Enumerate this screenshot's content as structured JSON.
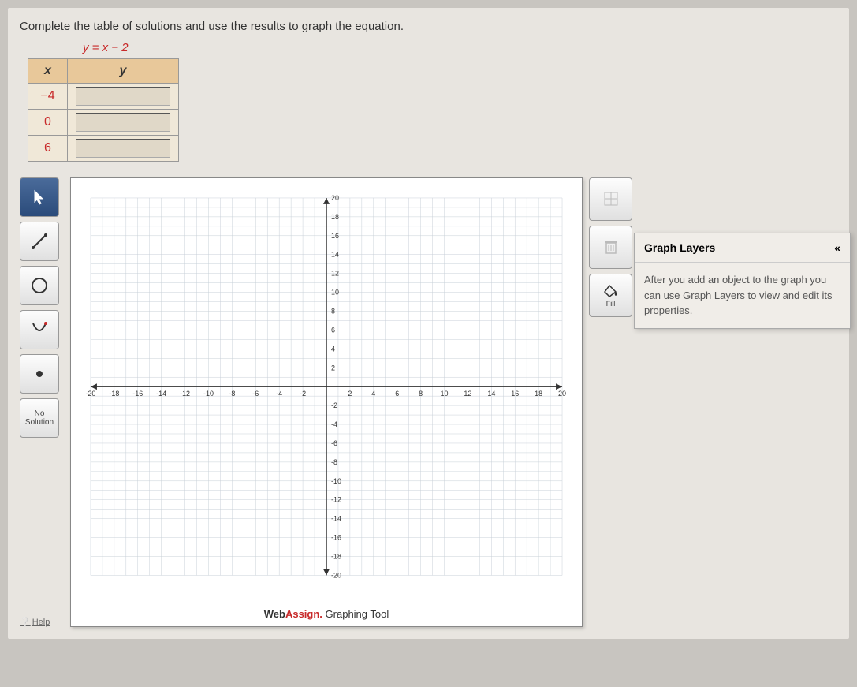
{
  "instruction": "Complete the table of solutions and use the results to graph the equation.",
  "equation": "y = x − 2",
  "table": {
    "headers": {
      "x": "x",
      "y": "y"
    },
    "rows": [
      {
        "x": "−4",
        "y": ""
      },
      {
        "x": "0",
        "y": ""
      },
      {
        "x": "6",
        "y": ""
      }
    ]
  },
  "tools": {
    "pointer": "pointer",
    "line": "line",
    "circle": "circle",
    "curve": "curve",
    "point": "point",
    "no_solution": "No Solution"
  },
  "right_tools": {
    "graph": "",
    "delete": "",
    "fill": "Fill"
  },
  "layers": {
    "title": "Graph Layers",
    "body": "After you add an object to the graph you can use Graph Layers to view and edit its properties."
  },
  "branding": {
    "web": "Web",
    "assign": "Assign.",
    "tool": " Graphing Tool"
  },
  "help": "Help",
  "chart_data": {
    "type": "scatter",
    "xlim": [
      -20,
      20
    ],
    "ylim": [
      -20,
      20
    ],
    "x_ticks": [
      -20,
      -18,
      -16,
      -14,
      -12,
      -10,
      -8,
      -6,
      -4,
      -2,
      2,
      4,
      6,
      8,
      10,
      12,
      14,
      16,
      18,
      20
    ],
    "y_ticks": [
      -20,
      -18,
      -16,
      -14,
      -12,
      -10,
      -8,
      -6,
      -4,
      -2,
      2,
      4,
      6,
      8,
      10,
      12,
      14,
      16,
      18,
      20
    ],
    "grid": true,
    "series": []
  }
}
